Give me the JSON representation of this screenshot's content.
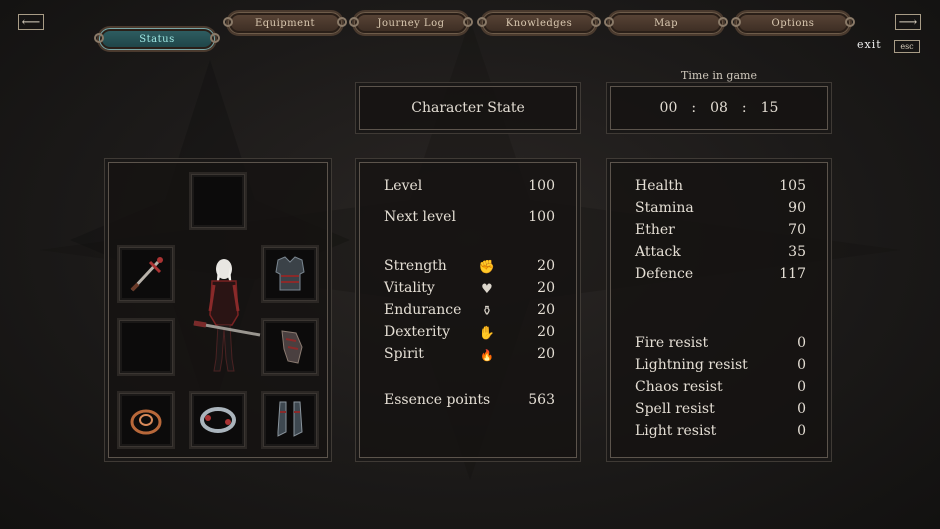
{
  "nav": {
    "back_icon": "arrow-left-icon",
    "forward_icon": "arrow-right-icon",
    "back_glyph": "⟵",
    "forward_glyph": "⟶",
    "exit_label": "exit",
    "esc_label": "esc"
  },
  "tabs": [
    {
      "label": "Status",
      "active": true
    },
    {
      "label": "Equipment",
      "active": false
    },
    {
      "label": "Journey Log",
      "active": false
    },
    {
      "label": "Knowledges",
      "active": false
    },
    {
      "label": "Map",
      "active": false
    },
    {
      "label": "Options",
      "active": false
    }
  ],
  "header": {
    "panel_title": "Character State",
    "time_label": "Time in game",
    "time": {
      "h": "00",
      "m": "08",
      "s": "15",
      "sep": ":"
    }
  },
  "equipment": {
    "slots": [
      {
        "slot": "helmet",
        "item": "empty"
      },
      {
        "slot": "weapon",
        "item": "sword-icon"
      },
      {
        "slot": "armor",
        "item": "chest-armor-icon"
      },
      {
        "slot": "offhand",
        "item": "empty"
      },
      {
        "slot": "gloves",
        "item": "gauntlet-icon"
      },
      {
        "slot": "ring",
        "item": "ring-icon"
      },
      {
        "slot": "amulet",
        "item": "bracelet-icon"
      },
      {
        "slot": "boots",
        "item": "boots-icon"
      }
    ]
  },
  "stats": {
    "level_label": "Level",
    "level": "100",
    "next_label": "Next level",
    "next": "100",
    "attributes": [
      {
        "label": "Strength",
        "value": "20",
        "icon": "fist-icon",
        "glyph": "✊"
      },
      {
        "label": "Vitality",
        "value": "20",
        "icon": "heart-icon",
        "glyph": "♥"
      },
      {
        "label": "Endurance",
        "value": "20",
        "icon": "kettlebell-icon",
        "glyph": "⚱"
      },
      {
        "label": "Dexterity",
        "value": "20",
        "icon": "hand-icon",
        "glyph": "✋"
      },
      {
        "label": "Spirit",
        "value": "20",
        "icon": "flame-icon",
        "glyph": "🔥"
      }
    ],
    "essence_label": "Essence points",
    "essence": "563"
  },
  "derived": {
    "main": [
      {
        "label": "Health",
        "value": "105"
      },
      {
        "label": "Stamina",
        "value": "90"
      },
      {
        "label": "Ether",
        "value": "70"
      },
      {
        "label": "Attack",
        "value": "35"
      },
      {
        "label": "Defence",
        "value": "117"
      }
    ],
    "resists": [
      {
        "label": "Fire resist",
        "value": "0"
      },
      {
        "label": "Lightning resist",
        "value": "0"
      },
      {
        "label": "Chaos resist",
        "value": "0"
      },
      {
        "label": "Spell resist",
        "value": "0"
      },
      {
        "label": "Light resist",
        "value": "0"
      }
    ]
  },
  "colors": {
    "active_tab": "#2f5f63",
    "active_tab_text": "#9fe8e4",
    "tab_frame": "#5a4537"
  }
}
